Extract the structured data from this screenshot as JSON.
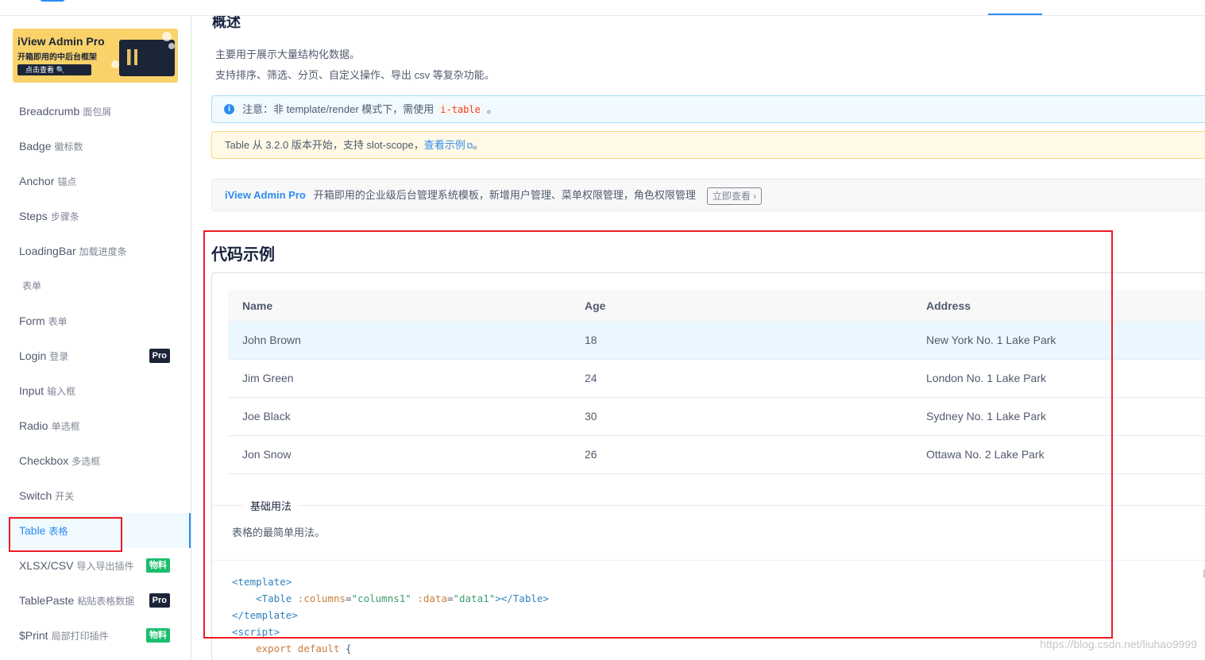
{
  "banner": {
    "title": "iView Admin Pro",
    "subtitle": "开箱即用的中后台框架",
    "button": "点击查看 🔍"
  },
  "sidebar": {
    "items": [
      {
        "label": "Breadcrumb",
        "zh": "面包屑",
        "tag": ""
      },
      {
        "label": "Badge",
        "zh": "徽标数",
        "tag": ""
      },
      {
        "label": "Anchor",
        "zh": "锚点",
        "tag": ""
      },
      {
        "label": "Steps",
        "zh": "步骤条",
        "tag": ""
      },
      {
        "label": "LoadingBar",
        "zh": "加载进度条",
        "tag": ""
      },
      {
        "label": "",
        "zh": "表单",
        "tag": "",
        "group": true
      },
      {
        "label": "Form",
        "zh": "表单",
        "tag": ""
      },
      {
        "label": "Login",
        "zh": "登录",
        "tag": "Pro"
      },
      {
        "label": "Input",
        "zh": "输入框",
        "tag": ""
      },
      {
        "label": "Radio",
        "zh": "单选框",
        "tag": ""
      },
      {
        "label": "Checkbox",
        "zh": "多选框",
        "tag": ""
      },
      {
        "label": "Switch",
        "zh": "开关",
        "tag": ""
      },
      {
        "label": "Table",
        "zh": "表格",
        "tag": "",
        "active": true
      },
      {
        "label": "XLSX/CSV",
        "zh": "导入导出插件",
        "tag": "物料"
      },
      {
        "label": "TablePaste",
        "zh": "粘贴表格数据",
        "tag": "Pro"
      },
      {
        "label": "$Print",
        "zh": "局部打印插件",
        "tag": "物料"
      }
    ]
  },
  "main": {
    "overview_title": "概述",
    "desc_line1": "主要用于展示大量结构化数据。",
    "desc_line2": "支持排序、筛选、分页、自定义操作、导出 csv 等复杂功能。",
    "info_alert": {
      "before": "注意：非 template/render 模式下，需使用",
      "code": "i-table",
      "after": "。"
    },
    "warn_alert": {
      "before": "Table 从 3.2.0 版本开始，支持 slot-scope，",
      "link": "查看示例",
      "after": "。"
    },
    "promo": {
      "title": "iView Admin Pro",
      "text": "开箱即用的企业级后台管理系统模板，新增用户管理、菜单权限管理，角色权限管理",
      "button": "立即查看 ›"
    },
    "demo_title": "代码示例",
    "table": {
      "headers": [
        "Name",
        "Age",
        "Address"
      ],
      "rows": [
        [
          "John Brown",
          "18",
          "New York No. 1 Lake Park"
        ],
        [
          "Jim Green",
          "24",
          "London No. 1 Lake Park"
        ],
        [
          "Joe Black",
          "30",
          "Sydney No. 1 Lake Park"
        ],
        [
          "Jon Snow",
          "26",
          "Ottawa No. 2 Lake Park"
        ]
      ]
    },
    "demo_section_label": "基础用法",
    "demo_desc": "表格的最简单用法。",
    "code": {
      "l1_tag": "<template>",
      "l2_open": "<Table",
      "l2_attr1": ":columns",
      "l2_val1": "\"columns1\"",
      "l2_attr2": ":data",
      "l2_val2": "\"data1\"",
      "l2_close": "></Table>",
      "l3_tag": "</template>",
      "l4_tag": "<script>",
      "l5_kw": "export default",
      "l5_rest": "{"
    }
  },
  "watermark": "https://blog.csdn.net/liuhao9999"
}
